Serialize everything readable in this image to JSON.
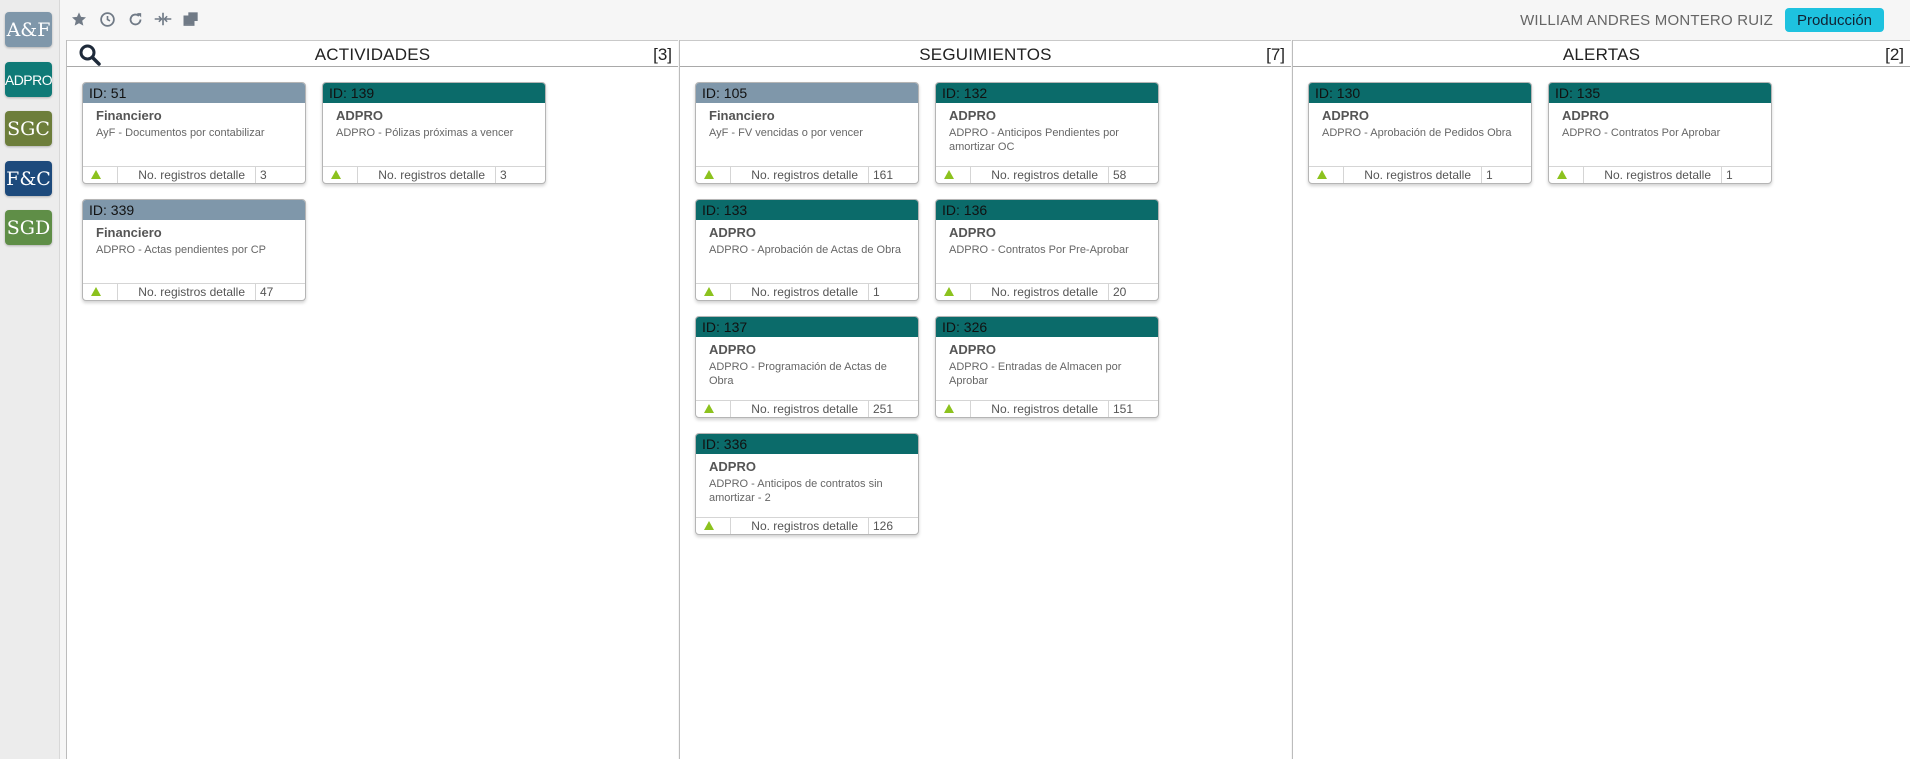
{
  "apps": [
    {
      "label": "A&F",
      "color": "#7f97aa",
      "name": "af"
    },
    {
      "label": "ADPRO",
      "color": "#0f7a77",
      "name": "adpro"
    },
    {
      "label": "SGC",
      "color": "#6d7e3b",
      "name": "sgc"
    },
    {
      "label": "F&C",
      "color": "#1d4a7c",
      "name": "fc"
    },
    {
      "label": "SGD",
      "color": "#5f8e47",
      "name": "sgd"
    }
  ],
  "toolbar": {
    "icons": [
      "star-icon",
      "history-icon",
      "refresh-icon",
      "split-columns-icon",
      "windows-icon"
    ]
  },
  "user": {
    "name": "WILLIAM ANDRES MONTERO RUIZ"
  },
  "environment": {
    "label": "Producción",
    "color": "#1ec2df"
  },
  "footer_label": "No. registros detalle",
  "panels": [
    {
      "title": "ACTIVIDADES",
      "count": "[3]",
      "cards": [
        {
          "id": "ID: 51",
          "category": "Financiero",
          "description": "AyF - Documentos por contabilizar",
          "records": "3",
          "header": "gray"
        },
        {
          "id": "ID: 139",
          "category": "ADPRO",
          "description": "ADPRO - Pólizas próximas a vencer",
          "records": "3",
          "header": "teal"
        },
        {
          "id": "ID: 339",
          "category": "Financiero",
          "description": "ADPRO - Actas pendientes por CP",
          "records": "47",
          "header": "gray"
        }
      ]
    },
    {
      "title": "SEGUIMIENTOS",
      "count": "[7]",
      "cards": [
        {
          "id": "ID: 105",
          "category": "Financiero",
          "description": "AyF - FV vencidas o por vencer",
          "records": "161",
          "header": "gray"
        },
        {
          "id": "ID: 132",
          "category": "ADPRO",
          "description": "ADPRO - Anticipos Pendientes por amortizar OC",
          "records": "58",
          "header": "teal"
        },
        {
          "id": "ID: 133",
          "category": "ADPRO",
          "description": "ADPRO - Aprobación de Actas de Obra",
          "records": "1",
          "header": "teal"
        },
        {
          "id": "ID: 136",
          "category": "ADPRO",
          "description": "ADPRO - Contratos Por Pre-Aprobar",
          "records": "20",
          "header": "teal"
        },
        {
          "id": "ID: 137",
          "category": "ADPRO",
          "description": "ADPRO - Programación de Actas de Obra",
          "records": "251",
          "header": "teal"
        },
        {
          "id": "ID: 326",
          "category": "ADPRO",
          "description": "ADPRO - Entradas de Almacen por Aprobar",
          "records": "151",
          "header": "teal"
        },
        {
          "id": "ID: 336",
          "category": "ADPRO",
          "description": "ADPRO - Anticipos de contratos sin amortizar - 2",
          "records": "126",
          "header": "teal"
        }
      ]
    },
    {
      "title": "ALERTAS",
      "count": "[2]",
      "cards": [
        {
          "id": "ID: 130",
          "category": "ADPRO",
          "description": "ADPRO - Aprobación de Pedidos Obra",
          "records": "1",
          "header": "teal"
        },
        {
          "id": "ID: 135",
          "category": "ADPRO",
          "description": "ADPRO - Contratos Por Aprobar",
          "records": "1",
          "header": "teal"
        }
      ]
    }
  ]
}
